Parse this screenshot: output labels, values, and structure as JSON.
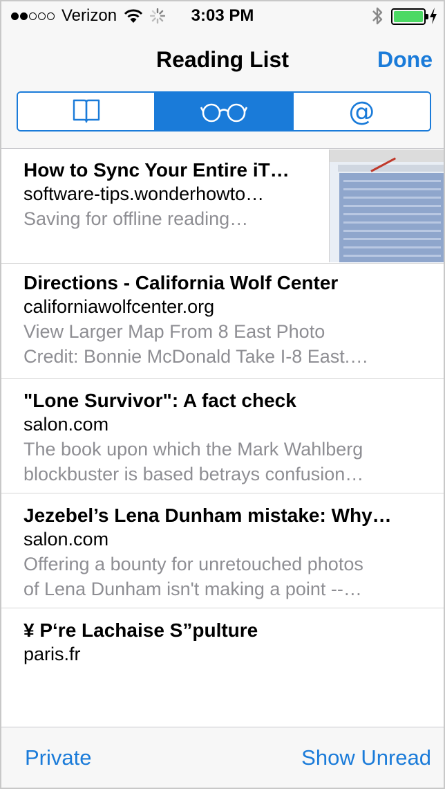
{
  "status_bar": {
    "carrier": "Verizon",
    "time": "3:03 PM",
    "signal_bars_filled": 2,
    "signal_bars_total": 5,
    "battery_level": 1.0,
    "battery_color": "#4cd964"
  },
  "nav": {
    "title": "Reading List",
    "done_label": "Done"
  },
  "segments": [
    {
      "icon": "book-icon",
      "active": false
    },
    {
      "icon": "glasses-icon",
      "active": true
    },
    {
      "icon": "at-icon",
      "label": "@",
      "active": false
    }
  ],
  "items": [
    {
      "title": "How to Sync Your Entire iT…",
      "domain": "software-tips.wonderhowto…",
      "preview_lines": [
        "Saving for offline reading…"
      ],
      "has_thumbnail": true
    },
    {
      "title": "Directions - California Wolf Center",
      "domain": "californiawolfcenter.org",
      "preview_lines": [
        "View Larger Map From 8 East Photo",
        "Credit: Bonnie McDonald Take I-8 East.…"
      ]
    },
    {
      "title": "\"Lone Survivor\": A fact check",
      "domain": "salon.com",
      "preview_lines": [
        "The book upon which the Mark Wahlberg",
        "blockbuster is based betrays confusion…"
      ]
    },
    {
      "title": "Jezebel’s Lena Dunham mistake: Why…",
      "domain": "salon.com",
      "preview_lines": [
        "Offering a bounty for unretouched photos",
        "of Lena Dunham isn't making a point --…"
      ]
    },
    {
      "title": "¥ P‘re Lachaise S”pulture",
      "domain": "paris.fr",
      "preview_lines": []
    }
  ],
  "toolbar": {
    "left_label": "Private",
    "right_label": "Show Unread"
  },
  "colors": {
    "accent": "#1a7bd9",
    "secondary_text": "#8e8e93",
    "bar_background": "#f7f7f7"
  }
}
